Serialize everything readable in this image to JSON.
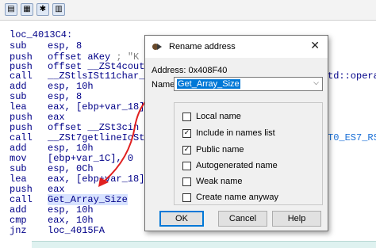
{
  "toolbar": {
    "buttons": [
      {
        "icon": "chart-icon",
        "glyph": "▤"
      },
      {
        "icon": "image-icon",
        "glyph": "▦"
      },
      {
        "icon": "gear-icon",
        "glyph": "✱"
      },
      {
        "icon": "grid-icon",
        "glyph": "▥"
      }
    ]
  },
  "code": {
    "label": "loc_4013C4:",
    "lines": [
      {
        "mn": "sub",
        "op": "esp, 8"
      },
      {
        "mn": "push",
        "op": "offset aKey",
        "cmt": " ; \"K"
      },
      {
        "mn": "push",
        "op": "offset __ZSt4cout",
        "cmt": " ;"
      },
      {
        "mn": "call",
        "op": "__ZStlsISt11char_tra"
      },
      {
        "mn": "add",
        "op": "esp, 10h"
      },
      {
        "mn": "sub",
        "op": "esp, 8"
      },
      {
        "mn": "lea",
        "op": "eax, [ebp+var_18]"
      },
      {
        "mn": "push",
        "op": "eax"
      },
      {
        "mn": "push",
        "op": "offset __ZSt3cin",
        "cmt": " ; s"
      },
      {
        "mn": "call",
        "op": "__ZSt7getlineIcSt11c"
      },
      {
        "mn": "add",
        "op": "esp, 10h"
      },
      {
        "mn": "mov",
        "op": "[ebp+var_1C], 0"
      },
      {
        "mn": "sub",
        "op": "esp, 0Ch"
      },
      {
        "mn": "lea",
        "op": "eax, [ebp+var_18]"
      },
      {
        "mn": "push",
        "op": "eax",
        "cmt": "               ; th"
      },
      {
        "mn": "call",
        "op": "Get_Array_Size"
      },
      {
        "mn": "add",
        "op": "esp, 10h"
      },
      {
        "mn": "cmp",
        "op": "eax, 10h"
      },
      {
        "mn": "jnz",
        "op": "loc_4015FA"
      }
    ],
    "side_right_1": "td::opera",
    "side_right_2": "T0_ES7_RS"
  },
  "dialog": {
    "title": "Rename address",
    "close": "✕",
    "address_label": "Address:",
    "address_value": "0x408F40",
    "name_label": "Name",
    "name_value": "Get_Array_Size",
    "checkboxes": [
      {
        "label": "Local name",
        "checked": false
      },
      {
        "label": "Include in names list",
        "checked": true
      },
      {
        "label": "Public name",
        "checked": true
      },
      {
        "label": "Autogenerated name",
        "checked": false
      },
      {
        "label": "Weak name",
        "checked": false
      },
      {
        "label": "Create name anyway",
        "checked": false
      }
    ],
    "ok_label": "OK",
    "cancel_label": "Cancel",
    "help_label": "Help"
  },
  "colors": {
    "code_text": "#000088",
    "comment": "#808080",
    "arrow": "#e02020",
    "selection": "#0078d7"
  }
}
